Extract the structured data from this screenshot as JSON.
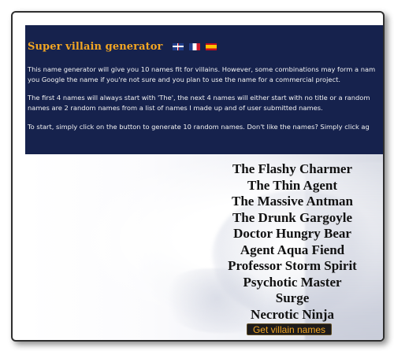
{
  "app": {
    "title": "Super villain generator"
  },
  "languages": [
    {
      "name": "English flag",
      "icon": "united-kingdom-flag-icon"
    },
    {
      "name": "French flag",
      "icon": "france-flag-icon"
    },
    {
      "name": "Spanish flag",
      "icon": "spain-flag-icon"
    }
  ],
  "description": {
    "paragraphs": [
      "This name generator will give you 10 names fit for villains. However, some combinations may form a nam",
      "you Google the name if you're not sure and you plan to use the name for a commercial project.",
      "The first 4 names will always start with 'The', the next 4 names will either start with no title or a random",
      "names are 2 random names from a list of names I made up and of user submitted names.",
      "To start, simply click on the button to generate 10 random names. Don't like the names? Simply click ag"
    ]
  },
  "generator": {
    "names": [
      "The Flashy Charmer",
      "The Thin Agent",
      "The Massive Antman",
      "The Drunk Gargoyle",
      "Doctor Hungry Bear",
      "Agent Aqua Fiend",
      "Professor Storm Spirit",
      "Psychotic Master",
      "Surge",
      "Necrotic Ninja"
    ],
    "button_label": "Get villain names"
  },
  "colors": {
    "panel_background": "#16224d",
    "title_color": "#f2a623",
    "button_background": "#1d1b1c",
    "button_text": "#f2a623"
  }
}
